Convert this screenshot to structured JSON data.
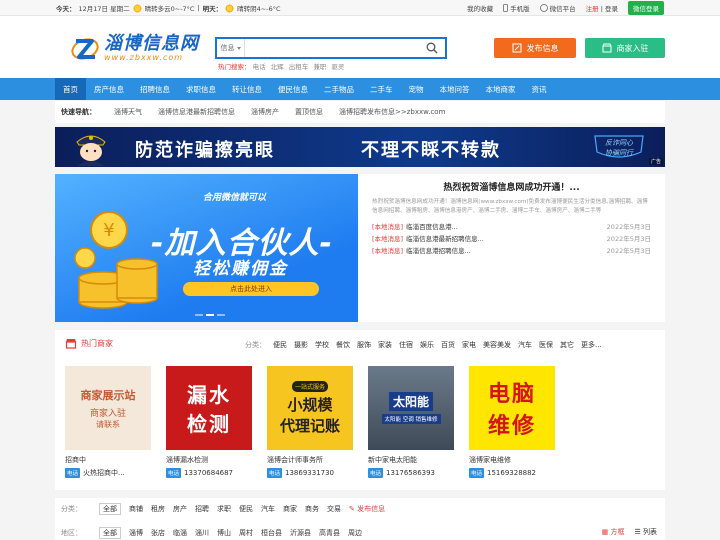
{
  "topbar": {
    "today_label": "今天：",
    "today_date": "12月17日 星期二",
    "today_weather": "晴转多云0~-7°C",
    "tomorrow_label": "明天：",
    "tomorrow_weather": "晴转阴4~-6°C",
    "links": [
      "我的收藏",
      "手机版",
      "微信平台"
    ],
    "register": "注册",
    "login": "登录",
    "wechat_login": "微信登录"
  },
  "header": {
    "logo_cn": "淄博信息网",
    "logo_url": "www.zbxxw.com",
    "search_select": "信息",
    "search_placeholder": "",
    "hot_label": "热门搜索：",
    "hot_keywords": [
      "电话",
      "北辉",
      "出租车",
      "兼职",
      "驱灵"
    ],
    "post_button": "发布信息",
    "join_button": "商家入驻"
  },
  "nav": {
    "items": [
      "首页",
      "房产信息",
      "招聘信息",
      "求职信息",
      "转让信息",
      "便民信息",
      "二手物品",
      "二手车",
      "宠物",
      "本地问答",
      "本地商家",
      "资讯"
    ]
  },
  "quick": {
    "label": "快速导航：",
    "items": [
      "淄博天气",
      "淄博信息港最新招聘信息",
      "淄博房产",
      "置顶信息",
      "淄博招聘发布信息>>zbxxw.com"
    ]
  },
  "banner": {
    "text1": "防范诈骗擦亮眼",
    "text2": "不理不睬不转款",
    "shield_text1": "反诈同心",
    "shield_text2": "协骗同行",
    "ad_tag": "广告"
  },
  "promo": {
    "line1": "合用微信就可以",
    "line2": "-加入合伙人-",
    "line3": "轻松赚佣金",
    "button": "点击此处进入"
  },
  "news": {
    "title": "热烈祝贺淄博信息网成功开通！...",
    "summary": "热烈祝贺淄博信息网成功开通！淄博信息网(www.zbxxw.com)免费发布淄博便民生活分类信息,淄博招聘、淄博信息网招聘、淄博租房、淄博信息港房产、淄博二手房、淄博二手车、淄博房产、淄博二手等",
    "items": [
      {
        "tag": "[本地消息]",
        "title": "临淄百度信息港...",
        "date": "2022年5月3日"
      },
      {
        "tag": "[本地消息]",
        "title": "临淄信息港最新招聘信息...",
        "date": "2022年5月3日"
      },
      {
        "tag": "[本地消息]",
        "title": "临淄信息港招聘信息...",
        "date": "2022年5月3日"
      }
    ]
  },
  "merchants": {
    "heading": "热门商家",
    "cat_label": "分类：",
    "categories": [
      "便民",
      "摄影",
      "学校",
      "餐饮",
      "服饰",
      "家装",
      "住宿",
      "娱乐",
      "百货",
      "家电",
      "美容美发",
      "汽车",
      "医保",
      "其它",
      "更多..."
    ],
    "cards": [
      {
        "name": "招商中",
        "phone_tag": "电话",
        "phone": "火热招商中...",
        "img_line1": "商家展示站",
        "img_line2": "商家入驻",
        "img_line3": "请联系"
      },
      {
        "name": "淄博漏水检测",
        "phone_tag": "电话",
        "phone": "13370684687",
        "img_line1": "漏水",
        "img_line2": "检测"
      },
      {
        "name": "淄博会计师事务所",
        "phone_tag": "电话",
        "phone": "13869331730",
        "img_line1": "小规模",
        "img_line2": "代理记账",
        "img_line3": "一站式服务"
      },
      {
        "name": "新中家电太阳能",
        "phone_tag": "电话",
        "phone": "13176586393",
        "img_line1": "太阳能",
        "img_line2": "太阳能 空调 销售维修"
      },
      {
        "name": "淄博家电维修",
        "phone_tag": "电话",
        "phone": "15169328882",
        "img_line1": "电脑",
        "img_line2": "维修"
      }
    ]
  },
  "filter": {
    "type_label": "分类：",
    "types": [
      "全部",
      "商铺",
      "租房",
      "房产",
      "招聘",
      "求职",
      "便民",
      "汽车",
      "商家",
      "商务",
      "交易"
    ],
    "post_label": "发布信息",
    "area_label": "地区：",
    "areas": [
      "全部",
      "淄博",
      "张店",
      "临淄",
      "淄川",
      "博山",
      "周村",
      "桓台县",
      "沂源县",
      "高青县",
      "周边"
    ],
    "view_grid": "方框",
    "view_list": "列表"
  },
  "colors": {
    "nav_blue": "#2c8fe0",
    "nav_active": "#1668b8",
    "accent_red": "#e63b3b",
    "post_orange": "#f46a1c",
    "join_green": "#2bbd86"
  }
}
